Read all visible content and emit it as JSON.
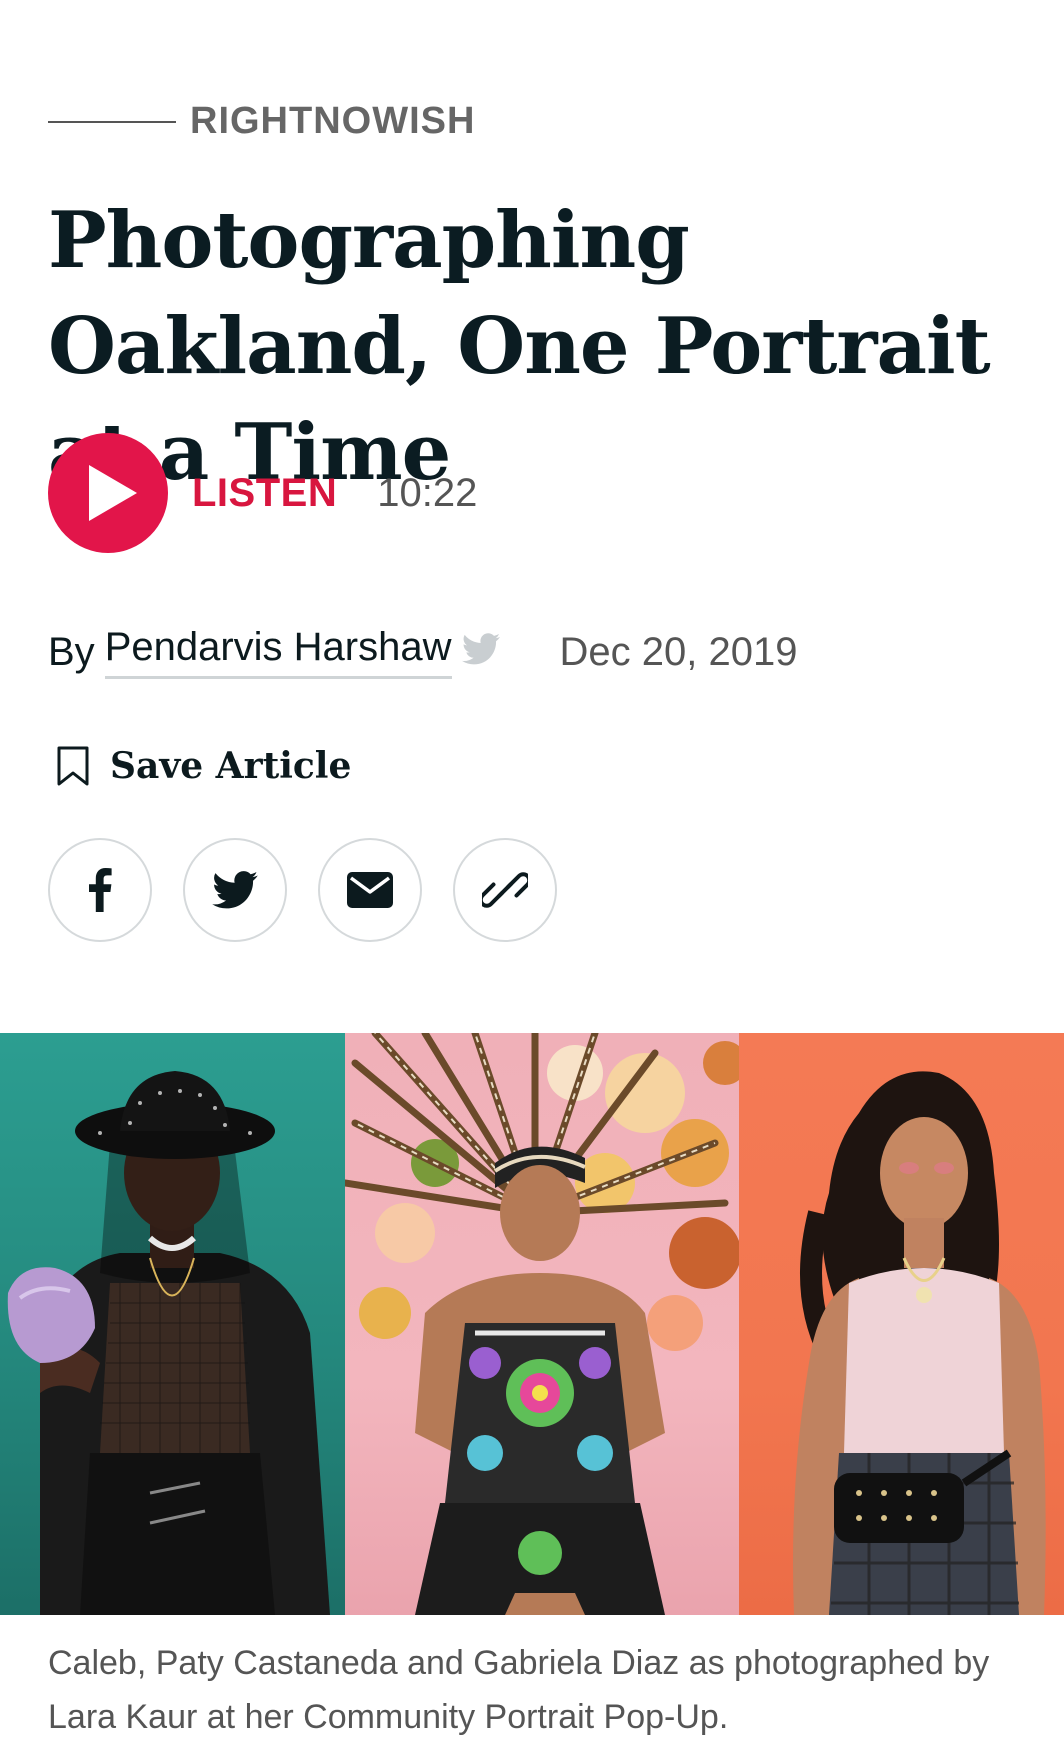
{
  "section": {
    "kicker": "RIGHTNOWISH"
  },
  "article": {
    "headline": "Photographing Oakland, One Portrait at a Time",
    "listen": {
      "label": "LISTEN",
      "duration": "10:22",
      "icon": "play-icon"
    },
    "byline": {
      "prefix": "By",
      "author": "Pendarvis Harshaw",
      "date": "Dec 20, 2019"
    },
    "save": {
      "label": "Save Article",
      "icon": "bookmark-icon"
    },
    "share": [
      {
        "name": "facebook",
        "icon": "facebook-icon"
      },
      {
        "name": "twitter",
        "icon": "twitter-icon"
      },
      {
        "name": "email",
        "icon": "envelope-icon"
      },
      {
        "name": "copy-link",
        "icon": "link-icon"
      }
    ],
    "image": {
      "caption": "Caleb, Paty Castaneda and Gabriela Diaz as photographed by Lara Kaur at her Community Portrait Pop-Up."
    }
  },
  "colors": {
    "accent": "#e2154a",
    "headline": "#0b1c22",
    "muted": "#555555",
    "border": "#d5d9db"
  }
}
